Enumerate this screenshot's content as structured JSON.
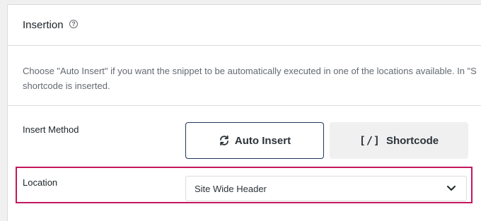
{
  "panel": {
    "title": "Insertion",
    "help_icon": "question-circle-icon",
    "description_line1": "Choose \"Auto Insert\" if you want the snippet to be automatically executed in one of the locations available. In \"S",
    "description_line2": "shortcode is inserted."
  },
  "insert_method": {
    "label": "Insert Method",
    "options": [
      {
        "label": "Auto Insert",
        "icon": "refresh-icon",
        "selected": true
      },
      {
        "label": "Shortcode",
        "icon": "shortcode-brackets-icon",
        "glyph": "[/]",
        "selected": false
      }
    ]
  },
  "location": {
    "label": "Location",
    "value": "Site Wide Header",
    "icon": "chevron-down-icon"
  },
  "colors": {
    "highlight": "#c2185b",
    "selected_border": "#1d3a5f",
    "panel_bg": "#ffffff",
    "page_bg": "#f0f0f1"
  }
}
